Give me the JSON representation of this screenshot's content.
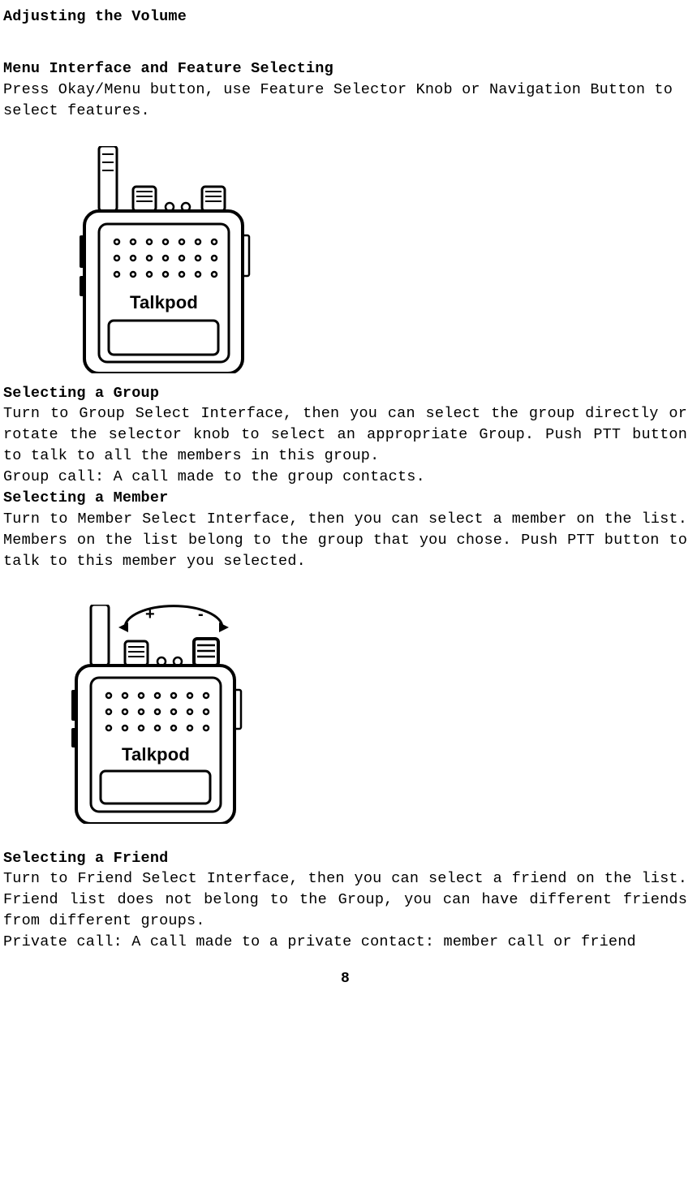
{
  "headings": {
    "h1": "Adjusting the Volume",
    "h2": "Menu Interface and Feature Selecting",
    "h3": "Selecting a Group",
    "h4": "Selecting a Member",
    "h5": "Selecting a Friend"
  },
  "paragraphs": {
    "p1": "Press Okay/Menu button, use Feature Selector Knob or Navigation Button to select features.",
    "p2": "Turn to Group Select Interface, then you can select the group directly or rotate the selector knob to select an appropriate Group. Push PTT button to talk to all the members in this group.",
    "p3": "Group call: A call made to the group contacts.",
    "p4": "Turn to Member Select Interface, then you can select a member on the list. Members on the list belong to the group that you chose. Push PTT button to talk to this member you selected.",
    "p5": "Turn to Friend Select Interface, then you can select a friend on the list. Friend list does not belong to the Group, you can have different friends from different groups.",
    "p6": "Private call: A call made to a private contact: member call or friend"
  },
  "brand": "Talkpod",
  "page_number": "8",
  "volume_labels": {
    "plus": "+",
    "minus": "-"
  }
}
